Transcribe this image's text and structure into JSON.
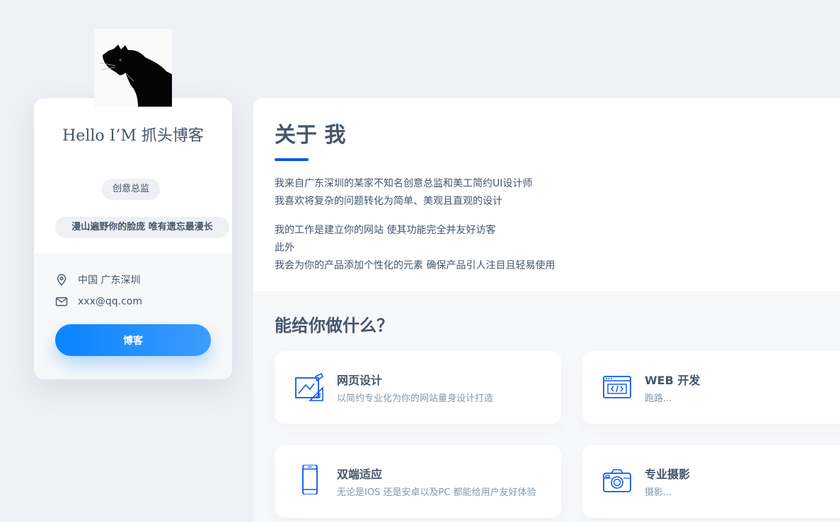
{
  "profile": {
    "avatar_icon": "black-cat-avatar",
    "name": "Hello I’M 抓头博客",
    "role": "创意总监",
    "quote": "漫山遍野你的脸庞 唯有遗忘最漫长",
    "location_icon": "map-pin-icon",
    "location": "中国 广东深圳",
    "email_icon": "mail-icon",
    "email": "xxx@qq.com",
    "blog_button": "博客"
  },
  "about": {
    "title": "关于 我",
    "lines": [
      "我来自广东深圳的某家不知名创意总监和美工简约UI设计师",
      "我喜欢将复杂的问题转化为简单、美观且直观的设计",
      "我的工作是建立你的网站 使其功能完全并友好访客",
      "此外",
      "我会为你的产品添加个性化的元素 确保产品引人注目且轻易使用"
    ]
  },
  "services": {
    "title": "能给你做什么？",
    "items": [
      {
        "icon": "design-drawing-icon",
        "title": "网页设计",
        "desc": "以简约专业化为你的网站量身设计打造"
      },
      {
        "icon": "web-code-icon",
        "title": "WEB 开发",
        "desc": "跑路..."
      },
      {
        "icon": "mobile-phone-icon",
        "title": "双端适应",
        "desc": "无论是IOS 还是安卓以及PC 都能给用户友好体验"
      },
      {
        "icon": "camera-icon",
        "title": "专业摄影",
        "desc": "摄影..."
      }
    ]
  },
  "colors": {
    "accent": "#0a58ec",
    "button_gradient_start": "#0a84ff",
    "button_gradient_end": "#3b9cfc",
    "text": "#44566c",
    "muted_text": "#8697a8",
    "background": "#eff0f6"
  }
}
